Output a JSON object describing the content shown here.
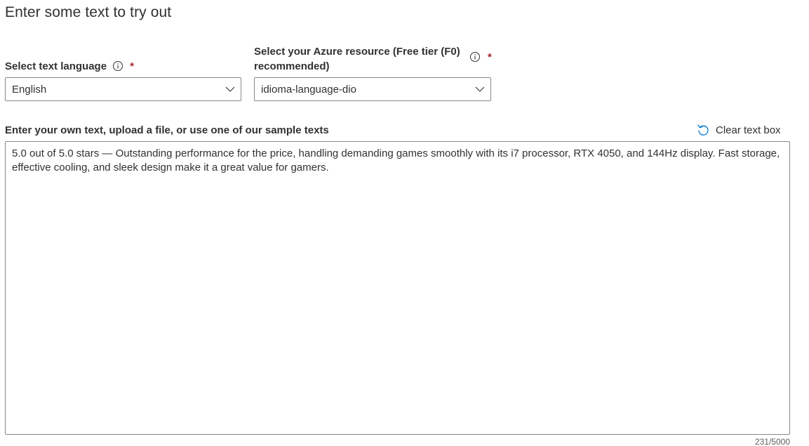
{
  "heading": "Enter some text to try out",
  "language_field": {
    "label": "Select text language",
    "required_mark": "*",
    "selected": "English"
  },
  "resource_field": {
    "label_line1": "Select your Azure resource (Free tier (F0)",
    "label_line2": "recommended)",
    "required_mark": "*",
    "selected": "idioma-language-dio"
  },
  "text_input": {
    "label": "Enter your own text, upload a file, or use one of our sample texts",
    "value": "5.0 out of 5.0 stars — Outstanding performance for the price, handling demanding games smoothly with its i7 processor, RTX 4050, and 144Hz display. Fast storage, effective cooling, and sleek design make it a great value for gamers.",
    "counter": "231/5000"
  },
  "clear_button": {
    "label": "Clear text box",
    "icon": "undo-icon"
  },
  "colors": {
    "text": "#323130",
    "border": "#8a8886",
    "required": "#a4262c",
    "accent": "#0078d4"
  }
}
